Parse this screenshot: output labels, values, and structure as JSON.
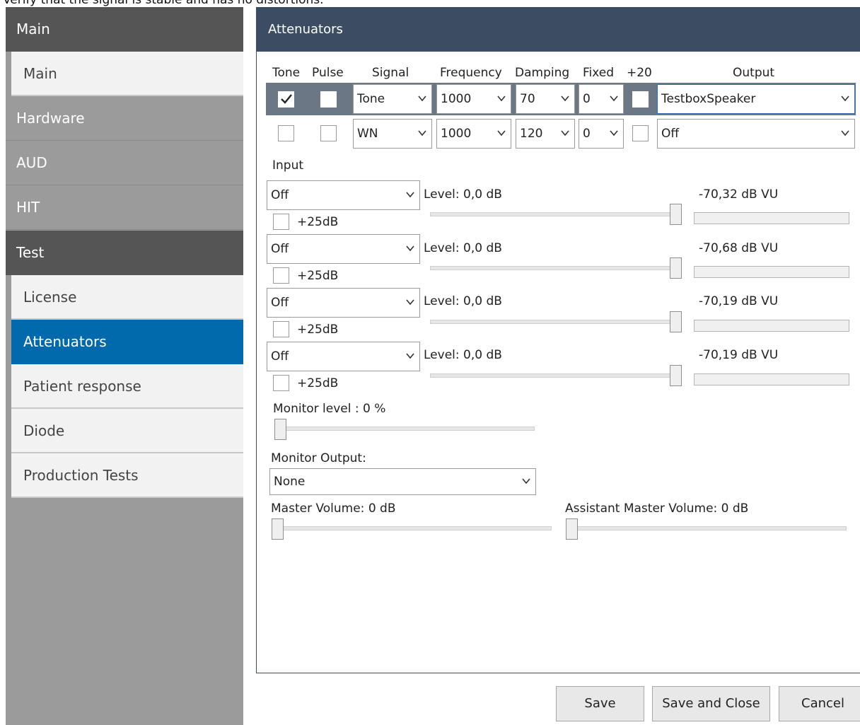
{
  "instruction": "Verify that the signal is stable and has no distortions.",
  "sidebar": {
    "header": "Main",
    "items": [
      {
        "label": "Main",
        "kind": "item"
      },
      {
        "label": "Hardware",
        "kind": "category"
      },
      {
        "label": "AUD",
        "kind": "category"
      },
      {
        "label": "HIT",
        "kind": "category"
      },
      {
        "label": "Test",
        "kind": "header"
      },
      {
        "label": "License",
        "kind": "item"
      },
      {
        "label": "Attenuators",
        "kind": "item",
        "active": true
      },
      {
        "label": "Patient response",
        "kind": "item"
      },
      {
        "label": "Diode",
        "kind": "item"
      },
      {
        "label": "Production Tests",
        "kind": "item"
      }
    ]
  },
  "panel": {
    "title": "Attenuators",
    "columns": [
      "Tone",
      "Pulse",
      "Signal",
      "Frequency",
      "Damping",
      "Fixed",
      "+20",
      "Output"
    ],
    "rows": [
      {
        "tone": true,
        "pulse": false,
        "signal": "Tone",
        "frequency": "1000",
        "damping": "70",
        "fixed": "0",
        "plus20": false,
        "output": "TestboxSpeaker",
        "selected": true
      },
      {
        "tone": false,
        "pulse": false,
        "signal": "WN",
        "frequency": "1000",
        "damping": "120",
        "fixed": "0",
        "plus20": false,
        "output": "Off",
        "selected": false
      }
    ],
    "input_label": "Input",
    "inputs": [
      {
        "source": "Off",
        "boost_label": "+25dB",
        "boost": false,
        "level_label": "Level: 0,0 dB",
        "level_fraction": 1.0,
        "vu": "-70,32 dB VU"
      },
      {
        "source": "Off",
        "boost_label": "+25dB",
        "boost": false,
        "level_label": "Level: 0,0 dB",
        "level_fraction": 1.0,
        "vu": "-70,68 dB VU"
      },
      {
        "source": "Off",
        "boost_label": "+25dB",
        "boost": false,
        "level_label": "Level: 0,0 dB",
        "level_fraction": 1.0,
        "vu": "-70,19 dB VU"
      },
      {
        "source": "Off",
        "boost_label": "+25dB",
        "boost": false,
        "level_label": "Level: 0,0 dB",
        "level_fraction": 1.0,
        "vu": "-70,19 dB VU"
      }
    ],
    "monitor_level_label": "Monitor level : 0 %",
    "monitor_level_fraction": 0,
    "monitor_output_label": "Monitor Output:",
    "monitor_output_value": "None",
    "master_volume_label": "Master Volume: 0 dB",
    "master_volume_fraction": 0,
    "assistant_volume_label": "Assistant Master Volume: 0 dB",
    "assistant_volume_fraction": 0
  },
  "buttons": {
    "save": "Save",
    "save_close": "Save and Close",
    "cancel": "Cancel"
  },
  "colors": {
    "sidebar_header": "#555555",
    "sidebar_bg": "#9b9b9b",
    "active": "#006aac",
    "panel_header": "#3c4d63",
    "selected_row": "#6b7785"
  },
  "icons": {
    "checkmark": "checkmark-icon",
    "dropdown": "chevron-down-icon"
  }
}
